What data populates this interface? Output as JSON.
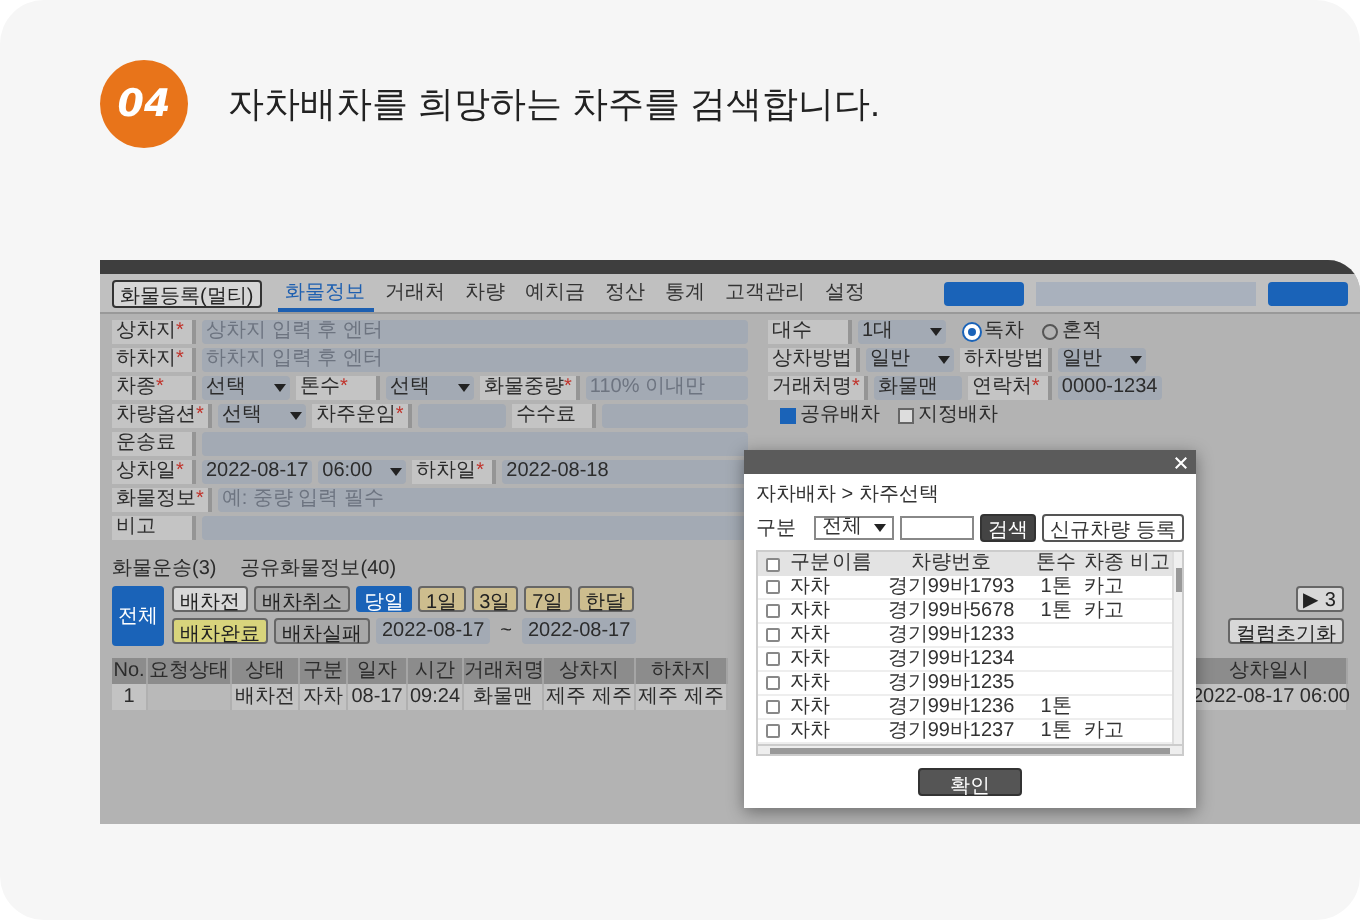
{
  "step": {
    "number": "04",
    "title": "자차배차를 희망하는 차주를 검색합니다."
  },
  "app": {
    "register_button": "화물등록(멀티)",
    "tabs": [
      {
        "label": "화물정보",
        "selected": true
      },
      {
        "label": "거래처",
        "selected": false
      },
      {
        "label": "차량",
        "selected": false
      },
      {
        "label": "예치금",
        "selected": false
      },
      {
        "label": "정산",
        "selected": false
      },
      {
        "label": "통계",
        "selected": false
      },
      {
        "label": "고객관리",
        "selected": false
      },
      {
        "label": "설정",
        "selected": false
      }
    ],
    "form_left": [
      {
        "fields": [
          {
            "label": "상차지",
            "mark": "*",
            "kind": "text",
            "placeholder": "상차지 입력 후 엔터"
          }
        ]
      },
      {
        "fields": [
          {
            "label": "하차지",
            "mark": "*",
            "kind": "text",
            "placeholder": "하차지 입력 후 엔터"
          }
        ]
      },
      {
        "fields": [
          {
            "label": "차종",
            "mark": "*",
            "kind": "select",
            "value": "선택"
          },
          {
            "label": "톤수",
            "mark": "*",
            "kind": "select",
            "value": "선택"
          },
          {
            "label": "화물중량",
            "mark": "*",
            "kind": "text",
            "placeholder": "110% 이내만"
          }
        ]
      },
      {
        "fields": [
          {
            "label": "차량옵션",
            "mark": "*",
            "kind": "select",
            "value": "선택"
          },
          {
            "label": "차주운임",
            "mark": "*",
            "kind": "text"
          },
          {
            "label": "수수료",
            "kind": "text"
          }
        ]
      },
      {
        "fields": [
          {
            "label": "운송료",
            "kind": "text"
          }
        ]
      },
      {
        "fields": [
          {
            "label": "상차일",
            "mark": "*",
            "kind": "text",
            "value": "2022-08-17"
          },
          {
            "kind": "select",
            "value": "06:00"
          },
          {
            "label": "하차일",
            "mark": "*",
            "kind": "text",
            "value": "2022-08-18"
          }
        ]
      },
      {
        "fields": [
          {
            "label": "화물정보",
            "mark": "*",
            "kind": "text",
            "placeholder": "예: 중량 입력 필수"
          }
        ]
      },
      {
        "fields": [
          {
            "label": "비고",
            "kind": "text"
          }
        ]
      }
    ],
    "form_right": [
      {
        "fields": [
          {
            "label": "대수",
            "kind": "select",
            "value": "1대"
          },
          {
            "kind": "radios",
            "options": [
              {
                "label": "독차",
                "selected": true
              },
              {
                "label": "혼적",
                "selected": false
              }
            ]
          }
        ]
      },
      {
        "fields": [
          {
            "label": "상차방법",
            "kind": "select",
            "value": "일반"
          },
          {
            "label": "하차방법",
            "kind": "select",
            "value": "일반"
          }
        ]
      },
      {
        "fields": [
          {
            "label": "거래처명",
            "mark": "*",
            "kind": "text",
            "value": "화물맨"
          },
          {
            "label": "연락처",
            "mark": "*",
            "kind": "text",
            "value": "0000-1234"
          }
        ]
      },
      {
        "fields": [
          {
            "kind": "checks",
            "options": [
              {
                "label": "공유배차",
                "checked": true
              },
              {
                "label": "지정배차",
                "checked": false
              }
            ]
          }
        ]
      }
    ],
    "list_counts": [
      "화물운송(3)",
      "공유화물정보(40)"
    ],
    "all_button": "전체",
    "filter_rows": [
      {
        "buttons": [
          {
            "label": "배차전",
            "kind": "plain",
            "selected": false
          },
          {
            "label": "배차취소",
            "kind": "muted",
            "selected": false
          },
          {
            "label": "당일",
            "kind": "period",
            "selected": true
          },
          {
            "label": "1일",
            "kind": "period",
            "selected": false
          },
          {
            "label": "3일",
            "kind": "period",
            "selected": false
          },
          {
            "label": "7일",
            "kind": "period",
            "selected": false
          },
          {
            "label": "한달",
            "kind": "period",
            "selected": false
          }
        ]
      },
      {
        "buttons": [
          {
            "label": "배차완료",
            "kind": "highlight",
            "selected": false
          },
          {
            "label": "배차실패",
            "kind": "muted",
            "selected": false
          }
        ],
        "date_from": "2022-08-17",
        "date_sep": "~",
        "date_to": "2022-08-17"
      }
    ],
    "pager": "▶ 3",
    "reset_columns": "컬럼초기화",
    "table": {
      "columns_left": [
        "No.",
        "요청상태",
        "상태",
        "구분",
        "일자",
        "시간",
        "거래처명",
        "상차지",
        "하차지"
      ],
      "columns_right": [
        "상차일시"
      ],
      "rows": [
        {
          "left": [
            {
              "text": "1"
            },
            {
              "kind": "empty"
            },
            {
              "text": "배차전"
            },
            {
              "text": "자차"
            },
            {
              "text": "08-17"
            },
            {
              "text": "09:24"
            },
            {
              "text": "화물맨"
            },
            {
              "text": "제주 제주"
            },
            {
              "text": "제주 제주"
            }
          ],
          "right": [
            {
              "text": "2022-08-17 06:00"
            }
          ]
        }
      ]
    }
  },
  "dialog": {
    "breadcrumb": "자차배차 > 차주선택",
    "filter_label": "구분",
    "filter_value": "전체",
    "search_button": "검색",
    "new_button": "신규차량 등록",
    "header_checked": false,
    "columns": [
      "구분",
      "이름",
      "차량번호",
      "톤수",
      "차종",
      "비고"
    ],
    "rows": [
      {
        "checked": false,
        "cells": [
          "자차",
          "",
          "경기99바1793",
          "1톤",
          "카고",
          ""
        ]
      },
      {
        "checked": false,
        "cells": [
          "자차",
          "",
          "경기99바5678",
          "1톤",
          "카고",
          ""
        ]
      },
      {
        "checked": false,
        "cells": [
          "자차",
          "",
          "경기99바1233",
          "",
          "",
          ""
        ]
      },
      {
        "checked": false,
        "cells": [
          "자차",
          "",
          "경기99바1234",
          "",
          "",
          ""
        ]
      },
      {
        "checked": false,
        "cells": [
          "자차",
          "",
          "경기99바1235",
          "",
          "",
          ""
        ]
      },
      {
        "checked": false,
        "cells": [
          "자차",
          "",
          "경기99바1236",
          "1톤",
          "",
          ""
        ]
      },
      {
        "checked": false,
        "cells": [
          "자차",
          "",
          "경기99바1237",
          "1톤",
          "카고",
          ""
        ]
      }
    ],
    "confirm_button": "확인"
  }
}
